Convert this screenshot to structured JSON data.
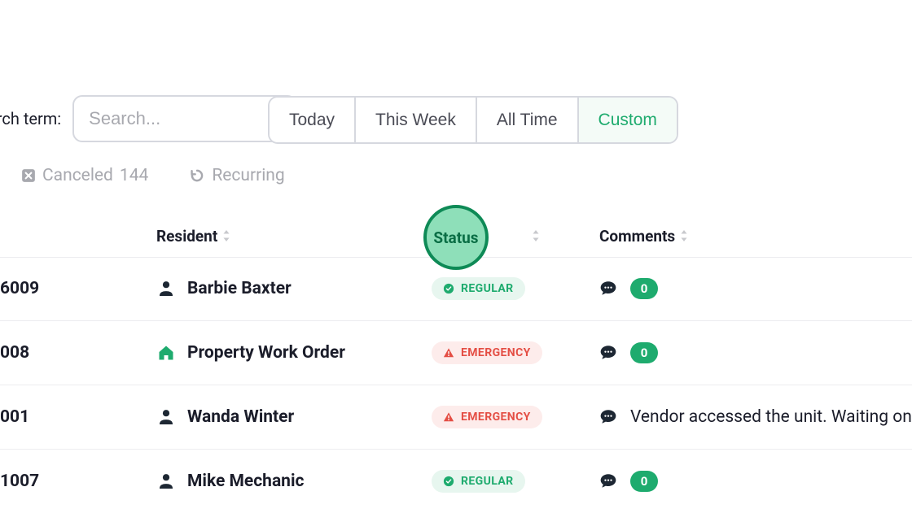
{
  "search": {
    "label": "search term:",
    "placeholder": "Search..."
  },
  "range_filters": {
    "items": [
      {
        "label": "Today",
        "active": false
      },
      {
        "label": "This Week",
        "active": false
      },
      {
        "label": "All Time",
        "active": false
      },
      {
        "label": "Custom",
        "active": true
      }
    ]
  },
  "secondary_filters": {
    "canceled": {
      "label": "Canceled",
      "count": "144"
    },
    "recurring": {
      "label": "Recurring"
    }
  },
  "columns": {
    "resident": "Resident",
    "status": "Status",
    "comments": "Comments"
  },
  "status_labels": {
    "regular": "REGULAR",
    "emergency": "EMERGENCY"
  },
  "rows": [
    {
      "id": "6009",
      "resident_type": "person",
      "resident_name": "Barbie Baxter",
      "status": "regular",
      "comment_text": "",
      "comment_count": "0"
    },
    {
      "id": "008",
      "resident_type": "property",
      "resident_name": "Property Work Order",
      "status": "emergency",
      "comment_text": "",
      "comment_count": "0"
    },
    {
      "id": "001",
      "resident_type": "person",
      "resident_name": "Wanda Winter",
      "status": "emergency",
      "comment_text": "Vendor accessed the unit. Waiting on",
      "comment_count": ""
    },
    {
      "id": "1007",
      "resident_type": "person",
      "resident_name": "Mike Mechanic",
      "status": "regular",
      "comment_text": "",
      "comment_count": "0"
    }
  ]
}
